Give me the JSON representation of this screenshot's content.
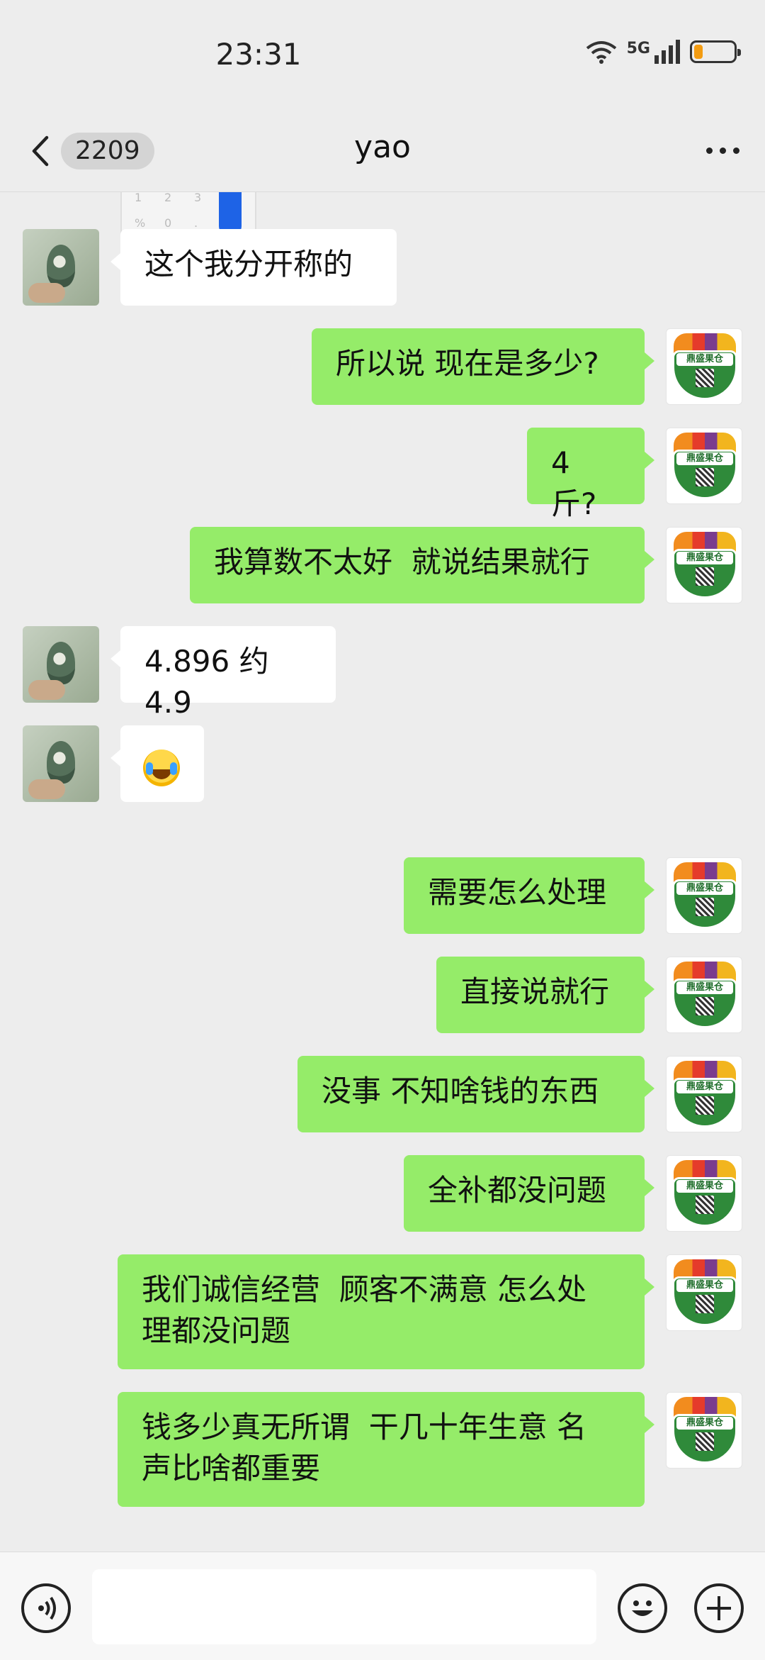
{
  "status_bar": {
    "time": "23:31",
    "network": "5G"
  },
  "header": {
    "unread_count": "2209",
    "title": "yao"
  },
  "chat": {
    "partial_image_keys": [
      "1",
      "2",
      "3",
      "%",
      "0",
      "."
    ],
    "right_avatar_brand": "鼎盛果仓",
    "messages": [
      {
        "side": "left",
        "text": "这个我分开称的"
      },
      {
        "side": "right",
        "text": "所以说 现在是多少?"
      },
      {
        "side": "right",
        "text": "4 斤?"
      },
      {
        "side": "right",
        "text": "我算数不太好  就说结果就行"
      },
      {
        "side": "left",
        "text": "4.896 约 4.9"
      },
      {
        "side": "left",
        "text": "",
        "emoji": "crying-laughing"
      },
      {
        "side": "right",
        "text": "需要怎么处理"
      },
      {
        "side": "right",
        "text": "直接说就行"
      },
      {
        "side": "right",
        "text": "没事 不知啥钱的东西"
      },
      {
        "side": "right",
        "text": "全补都没问题"
      },
      {
        "side": "right",
        "text": "我们诚信经营  顾客不满意 怎么处\n理都没问题"
      },
      {
        "side": "right",
        "text": "钱多少真无所谓  干几十年生意 名\n声比啥都重要"
      }
    ]
  },
  "input_bar": {
    "value": "",
    "placeholder": ""
  },
  "icons": {
    "back": "chevron-left-icon",
    "more": "more-dots-icon",
    "voice": "voice-icon",
    "emoji": "emoji-icon",
    "plus": "plus-icon",
    "wifi": "wifi-icon",
    "signal": "signal-icon",
    "battery": "battery-icon"
  },
  "colors": {
    "bubble_right": "#95ec69",
    "bubble_left": "#ffffff",
    "background": "#ededed",
    "battery_low": "#f39c12"
  }
}
